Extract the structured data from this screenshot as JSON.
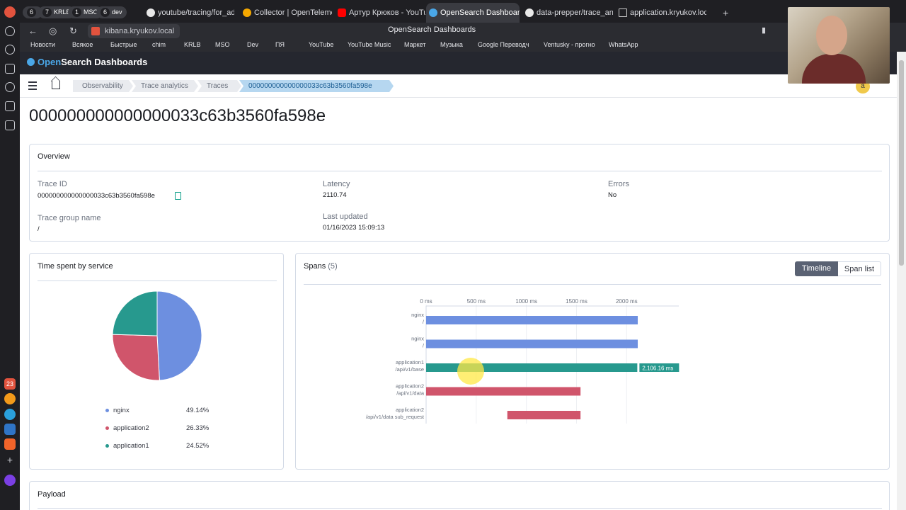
{
  "tabs": {
    "pills": [
      {
        "num": "6",
        "label": ""
      },
      {
        "num": "7",
        "label": "KRLB"
      },
      {
        "num": "1",
        "label": "MSO"
      },
      {
        "num": "6",
        "label": "dev"
      }
    ],
    "items": [
      {
        "label": "youtube/tracing/for_admin"
      },
      {
        "label": "Collector | OpenTelemetry"
      },
      {
        "label": "Артур Крюков - YouTube"
      },
      {
        "label": "OpenSearch Dashboards"
      },
      {
        "label": "data-prepper/trace_analyt"
      },
      {
        "label": "application.kryukov.local/a"
      }
    ]
  },
  "address": {
    "url": "kibana.kryukov.local",
    "page_title": "OpenSearch Dashboards"
  },
  "bookmarks": [
    "Новости",
    "Всякое",
    "Быстрые",
    "chim",
    "KRLB",
    "MSO",
    "Dev",
    "ПЯ",
    "YouTube",
    "YouTube Music",
    "Маркет",
    "Музыка",
    "Google Переводч",
    "Ventusky - прогно",
    "WhatsApp"
  ],
  "sidebar_badge": "23",
  "app": {
    "brand_prefix": "Open",
    "brand_suffix": "Search Dashboards",
    "breadcrumbs": [
      "Observability",
      "Trace analytics",
      "Traces",
      "000000000000000033c63b3560fa598e"
    ],
    "user_initial": "a"
  },
  "page": {
    "title": "000000000000000033c63b3560fa598e"
  },
  "overview": {
    "title": "Overview",
    "trace_id_label": "Trace ID",
    "trace_id": "000000000000000033c63b3560fa598e",
    "trace_group_label": "Trace group name",
    "trace_group": "/",
    "latency_label": "Latency",
    "latency": "2110.74",
    "last_updated_label": "Last updated",
    "last_updated": "01/16/2023 15:09:13",
    "errors_label": "Errors",
    "errors": "No"
  },
  "service_panel": {
    "title": "Time spent by service"
  },
  "spans_panel": {
    "title": "Spans",
    "count": "(5)",
    "toggle": [
      "Timeline",
      "Span list"
    ],
    "active_toggle": "Timeline"
  },
  "payload": {
    "title": "Payload"
  },
  "colors": {
    "nginx": "#6d8fe0",
    "application2": "#d0556b",
    "application1": "#27998e",
    "accent": "#0077cc"
  },
  "chart_data": [
    {
      "type": "pie",
      "title": "Time spent by service",
      "labels": [
        "nginx",
        "application2",
        "application1"
      ],
      "values": [
        49.14,
        26.33,
        24.52
      ],
      "value_labels": [
        "49.14%",
        "26.33%",
        "24.52%"
      ],
      "legend": "bottom"
    },
    {
      "type": "bar",
      "orientation": "horizontal",
      "title": "Spans",
      "x_ticks": [
        "0 ms",
        "500 ms",
        "1000 ms",
        "1500 ms",
        "2000 ms"
      ],
      "x_tick_values": [
        0,
        500,
        1000,
        1500,
        2000
      ],
      "xlim": [
        0,
        2520
      ],
      "grid": true,
      "spans": [
        {
          "service": "nginx",
          "operation": "/",
          "start": 0,
          "end": 2110.74
        },
        {
          "service": "nginx",
          "operation": "/",
          "start": 0,
          "end": 2110.74
        },
        {
          "service": "application1",
          "operation": "/api/v1/base",
          "start": 0,
          "end": 2106.16,
          "label": "2,106.16 ms"
        },
        {
          "service": "application2",
          "operation": "/api/v1/data",
          "start": 0,
          "end": 1540
        },
        {
          "service": "application2",
          "operation": "/api/v1/data sub_request",
          "start": 810,
          "end": 1540
        }
      ]
    }
  ]
}
